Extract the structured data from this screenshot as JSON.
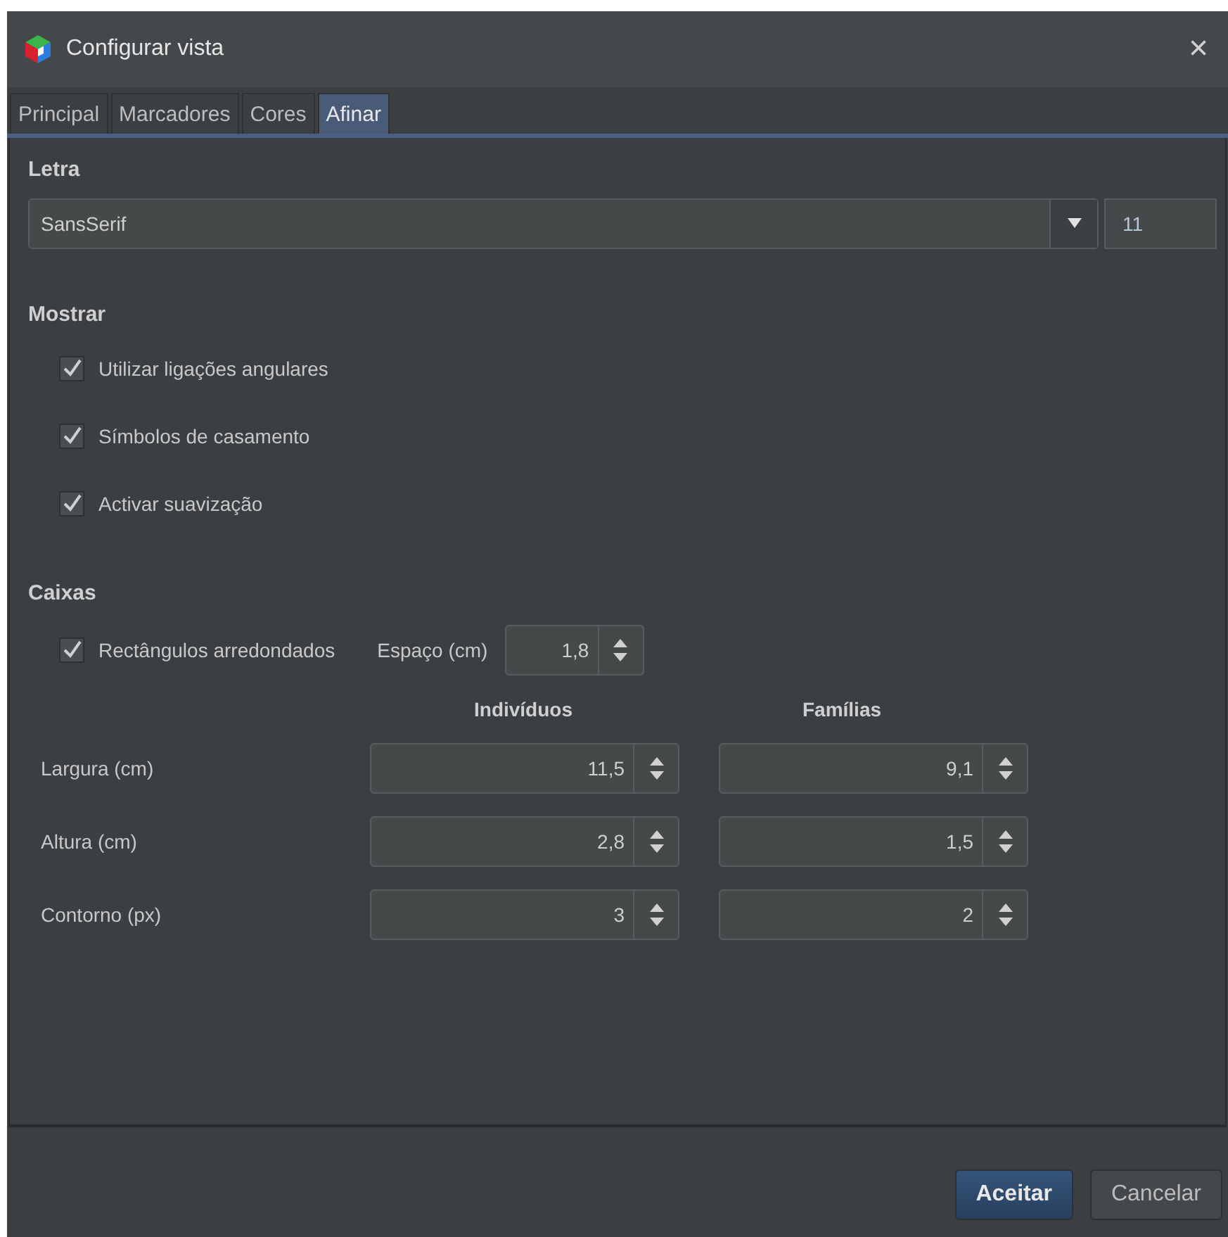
{
  "window": {
    "title": "Configurar vista",
    "close": "×"
  },
  "tabs": [
    {
      "label": "Principal",
      "selected": false
    },
    {
      "label": "Marcadores",
      "selected": false
    },
    {
      "label": "Cores",
      "selected": false
    },
    {
      "label": "Afinar",
      "selected": true
    }
  ],
  "font": {
    "heading": "Letra",
    "family": "SansSerif",
    "size": "11"
  },
  "display": {
    "heading": "Mostrar",
    "options": [
      {
        "label": "Utilizar ligações angulares",
        "checked": true
      },
      {
        "label": "Símbolos de casamento",
        "checked": true
      },
      {
        "label": "Activar suavização",
        "checked": true
      }
    ]
  },
  "boxes": {
    "heading": "Caixas",
    "rounded": {
      "label": "Rectângulos arredondados",
      "checked": true
    },
    "spacing": {
      "label": "Espaço (cm)",
      "value": "1,8"
    },
    "columns": [
      "Indivíduos",
      "Famílias"
    ],
    "rows": [
      {
        "label": "Largura (cm)",
        "values": [
          "11,5",
          "9,1"
        ]
      },
      {
        "label": "Altura (cm)",
        "values": [
          "2,8",
          "1,5"
        ]
      },
      {
        "label": "Contorno (px)",
        "values": [
          "3",
          "2"
        ]
      }
    ]
  },
  "buttons": [
    {
      "label": "Aceitar",
      "kind": "primary"
    },
    {
      "label": "Cancelar",
      "kind": "secondary"
    }
  ]
}
